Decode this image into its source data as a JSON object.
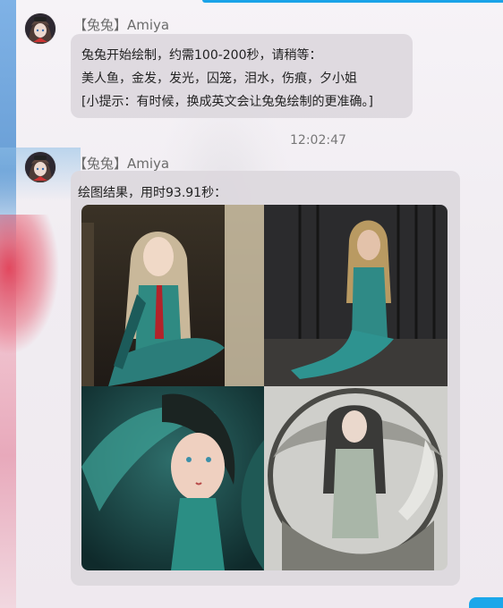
{
  "messages": [
    {
      "sender": "【兔兔】Amiya",
      "lines": [
        "兔兔开始绘制，约需100-200秒，请稍等：",
        "美人鱼，金发，发光，囚笼，泪水，伤痕，夕小姐",
        "[小提示：有时候，换成英文会让兔兔绘制的更准确。]"
      ]
    },
    {
      "timestamp": "12:02:47",
      "sender": "【兔兔】Amiya",
      "caption": "绘图结果，用时93.91秒：",
      "images": [
        "mermaid-image-1",
        "mermaid-image-2",
        "mermaid-image-3",
        "mermaid-image-4"
      ]
    }
  ],
  "colors": {
    "accent": "#1aa3e8",
    "bubble": "#dcd8dd",
    "sender_text": "#6b6b6b"
  }
}
